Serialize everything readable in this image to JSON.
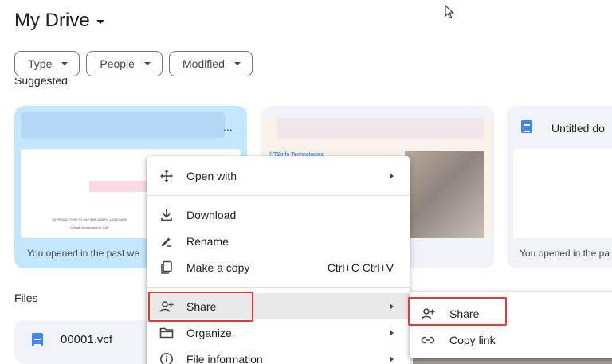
{
  "header": {
    "title": "My Drive"
  },
  "filters": [
    {
      "label": "Type"
    },
    {
      "label": "People"
    },
    {
      "label": "Modified"
    }
  ],
  "suggested": {
    "label": "Suggested",
    "cards": [
      {
        "opened": "You opened in the past we",
        "preview_line1": "INTRODUCTION TO SAP AND ABAP/4 LANGUAGE",
        "preview_line2": "•  Overall introduction to SAP",
        "more": "..."
      },
      {
        "brand": "©TSinfo Technologies"
      },
      {
        "title": "Untitled do",
        "opened": "You opened in the pa"
      }
    ]
  },
  "files": {
    "label": "Files",
    "items": [
      {
        "name": "00001.vcf"
      }
    ]
  },
  "context_menu": {
    "items": [
      {
        "label": "Open with",
        "icon": "open-with-icon",
        "submenu": true
      },
      {
        "label": "Download",
        "icon": "download-icon"
      },
      {
        "label": "Rename",
        "icon": "rename-icon"
      },
      {
        "label": "Make a copy",
        "icon": "copy-icon",
        "shortcut": "Ctrl+C Ctrl+V"
      },
      {
        "label": "Share",
        "icon": "share-icon",
        "submenu": true,
        "active": true
      },
      {
        "label": "Organize",
        "icon": "folder-icon",
        "submenu": true
      },
      {
        "label": "File information",
        "icon": "info-icon",
        "submenu": true
      }
    ]
  },
  "share_submenu": {
    "items": [
      {
        "label": "Share",
        "icon": "share-icon"
      },
      {
        "label": "Copy link",
        "icon": "link-icon"
      }
    ]
  },
  "colors": {
    "selected_card": "#c2e7ff",
    "card_bg": "#f0f4f9",
    "highlight": "#e53935",
    "accent": "#4285f4"
  }
}
